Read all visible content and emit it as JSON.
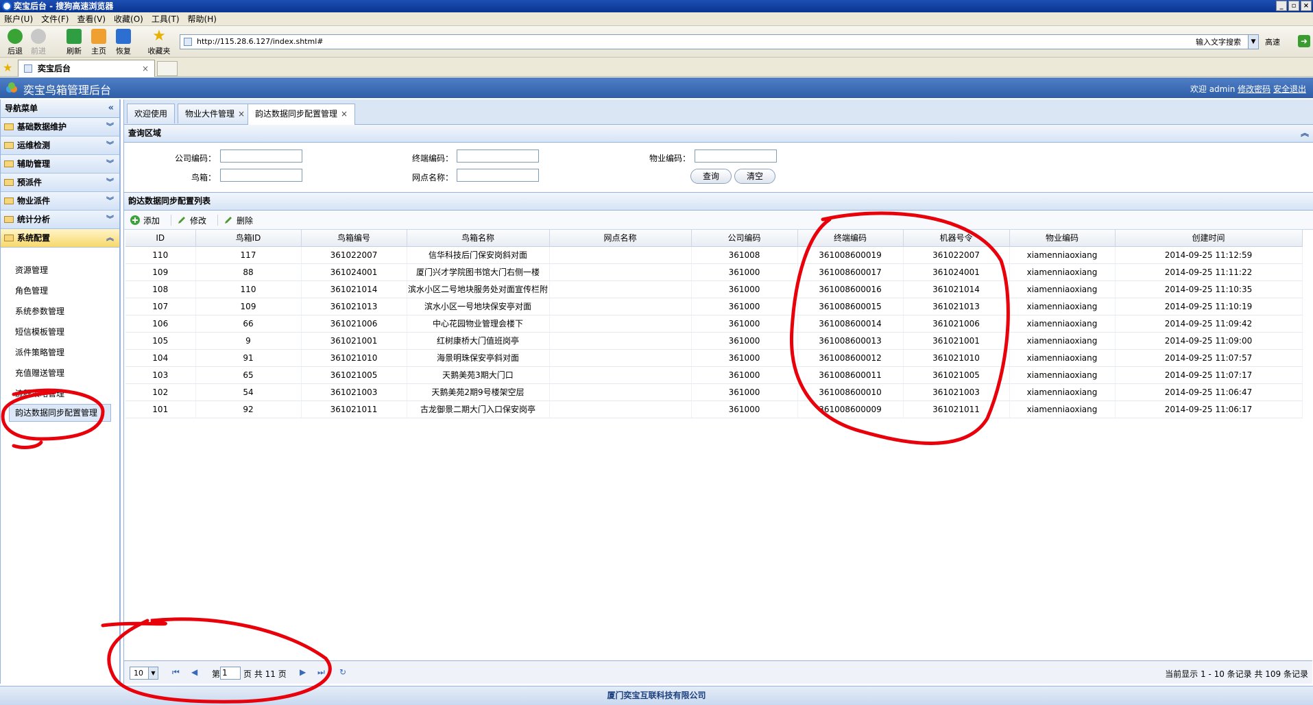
{
  "browser": {
    "title": "奕宝后台 - 搜狗高速浏览器",
    "menu": [
      "账户(U)",
      "文件(F)",
      "查看(V)",
      "收藏(O)",
      "工具(T)",
      "帮助(H)"
    ],
    "toolbar": {
      "back": "后退",
      "forward": "前进",
      "refresh": "刷新",
      "home": "主页",
      "restore": "恢复",
      "favorites": "收藏夹"
    },
    "url": "http://115.28.6.127/index.shtml#",
    "search_hint": "输入文字搜索",
    "speed": "高速",
    "tab_title": "奕宝后台",
    "tab_close": "×"
  },
  "app": {
    "title": "奕宝鸟箱管理后台",
    "welcome": "欢迎 admin",
    "change_password": "修改密码",
    "logout": "安全退出",
    "footer": "厦门奕宝互联科技有限公司"
  },
  "sidebar": {
    "header": "导航菜单",
    "collapse_glyph": "«",
    "groups": [
      {
        "label": "基础数据维护"
      },
      {
        "label": "运维检测"
      },
      {
        "label": "辅助管理"
      },
      {
        "label": "预派件"
      },
      {
        "label": "物业派件"
      },
      {
        "label": "统计分析"
      },
      {
        "label": "系统配置"
      }
    ],
    "sub_items": [
      "资源管理",
      "角色管理",
      "系统参数管理",
      "短信模板管理",
      "派件策略管理",
      "充值赠送管理",
      "流程策略管理",
      "韵达数据同步配置管理"
    ]
  },
  "tabs": [
    {
      "label": "欢迎使用",
      "closable": false
    },
    {
      "label": "物业大件管理",
      "closable": true
    },
    {
      "label": "韵达数据同步配置管理",
      "closable": true
    }
  ],
  "query": {
    "title": "查询区域",
    "company_code_label": "公司编码：",
    "terminal_code_label": "终端编码：",
    "property_code_label": "物业编码：",
    "box_label": "鸟箱：",
    "site_name_label": "网点名称：",
    "search_btn": "查询",
    "clear_btn": "清空"
  },
  "grid": {
    "title": "韵达数据同步配置列表",
    "add": "添加",
    "edit": "修改",
    "delete": "删除",
    "columns": [
      "ID",
      "鸟箱ID",
      "鸟箱编号",
      "鸟箱名称",
      "网点名称",
      "公司编码",
      "终端编码",
      "机器号令",
      "物业编码",
      "创建时间"
    ],
    "rows": [
      [
        "110",
        "117",
        "361022007",
        "信华科技后门保安岗斜对面",
        "",
        "361008",
        "361008600019",
        "361022007",
        "xiamenniaoxiang",
        "2014-09-25 11:12:59"
      ],
      [
        "109",
        "88",
        "361024001",
        "厦门兴才学院图书馆大门右侧一楼",
        "",
        "361000",
        "361008600017",
        "361024001",
        "xiamenniaoxiang",
        "2014-09-25 11:11:22"
      ],
      [
        "108",
        "110",
        "361021014",
        "滨水小区二号地块服务处对面宣传栏附",
        "",
        "361000",
        "361008600016",
        "361021014",
        "xiamenniaoxiang",
        "2014-09-25 11:10:35"
      ],
      [
        "107",
        "109",
        "361021013",
        "滨水小区一号地块保安亭对面",
        "",
        "361000",
        "361008600015",
        "361021013",
        "xiamenniaoxiang",
        "2014-09-25 11:10:19"
      ],
      [
        "106",
        "66",
        "361021006",
        "中心花园物业管理会楼下",
        "",
        "361000",
        "361008600014",
        "361021006",
        "xiamenniaoxiang",
        "2014-09-25 11:09:42"
      ],
      [
        "105",
        "9",
        "361021001",
        "红树康桥大门值班岗亭",
        "",
        "361000",
        "361008600013",
        "361021001",
        "xiamenniaoxiang",
        "2014-09-25 11:09:00"
      ],
      [
        "104",
        "91",
        "361021010",
        "海景明珠保安亭斜对面",
        "",
        "361000",
        "361008600012",
        "361021010",
        "xiamenniaoxiang",
        "2014-09-25 11:07:57"
      ],
      [
        "103",
        "65",
        "361021005",
        "天鹅美苑3期大门口",
        "",
        "361000",
        "361008600011",
        "361021005",
        "xiamenniaoxiang",
        "2014-09-25 11:07:17"
      ],
      [
        "102",
        "54",
        "361021003",
        "天鹅美苑2期9号楼架空层",
        "",
        "361000",
        "361008600010",
        "361021003",
        "xiamenniaoxiang",
        "2014-09-25 11:06:47"
      ],
      [
        "101",
        "92",
        "361021011",
        "古龙御景二期大门入口保安岗亭",
        "",
        "361000",
        "361008600009",
        "361021011",
        "xiamenniaoxiang",
        "2014-09-25 11:06:17"
      ]
    ]
  },
  "pager": {
    "page_size": "10",
    "page_prefix": "第",
    "current_page": "1",
    "page_suffix": "页 共 11 页",
    "info": "当前显示 1 - 10 条记录 共 109 条记录"
  },
  "colors": {
    "header_blue": "#2f5ea8",
    "border_blue": "#95b3dc",
    "annotation_red": "#e8000b"
  }
}
